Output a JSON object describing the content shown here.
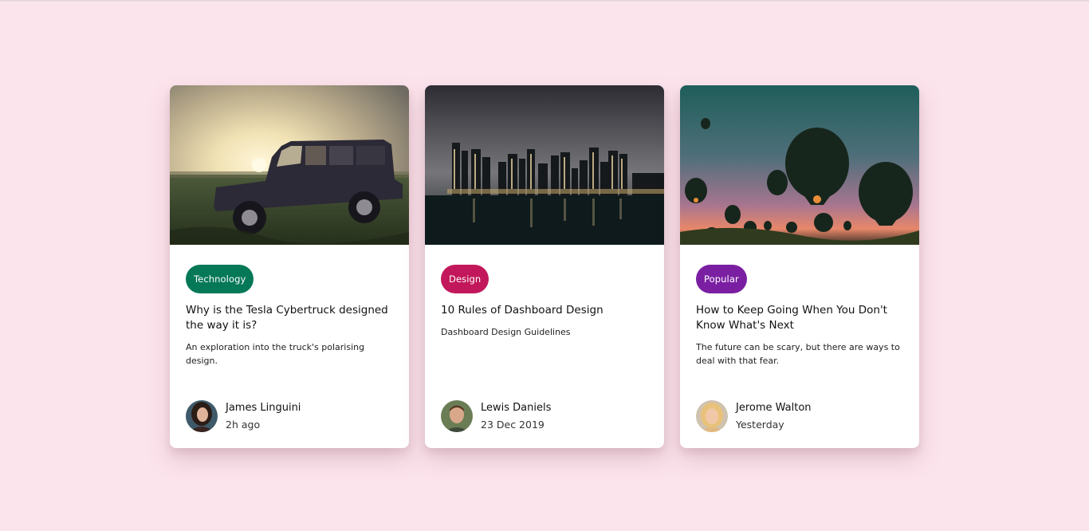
{
  "cards": [
    {
      "image": "vintage-truck-at-sunset",
      "tag": "Technology",
      "tag_color": "#047857",
      "title": "Why is the Tesla Cybertruck designed the way it is?",
      "description": "An exploration into the truck's polarising design.",
      "author": {
        "name": "James Linguini",
        "meta": "2h ago"
      }
    },
    {
      "image": "city-skyline-at-night",
      "tag": "Design",
      "tag_color": "#c2185b",
      "title": "10 Rules of Dashboard Design",
      "description": "Dashboard Design Guidelines",
      "author": {
        "name": "Lewis Daniels",
        "meta": "23 Dec 2019"
      }
    },
    {
      "image": "hot-air-balloons-at-dusk",
      "tag": "Popular",
      "tag_color": "#7b1fa2",
      "title": "How to Keep Going When You Don't Know What's Next",
      "description": "The future can be scary, but there are ways to deal with that fear.",
      "author": {
        "name": "Jerome Walton",
        "meta": "Yesterday"
      }
    }
  ]
}
